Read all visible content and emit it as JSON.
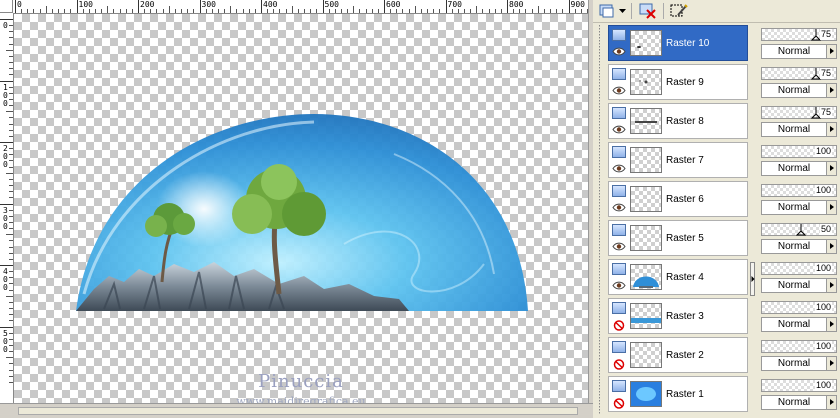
{
  "ruler": {
    "horizontal_labels": [
      "0",
      "100",
      "200",
      "300",
      "400",
      "500",
      "600",
      "700",
      "800",
      "900"
    ],
    "vertical_labels": [
      "0",
      "1 0 0",
      "2 0 0",
      "3 0 0",
      "4 0 0",
      "5 0 0"
    ]
  },
  "canvas": {
    "watermark_title": "Pinuccia",
    "watermark_url": "www.maidiregrafica.eu"
  },
  "toolbar": {
    "icons": [
      "new-layer-icon",
      "dropdown-arrow-icon",
      "delete-layer-icon",
      "edit-selection-icon"
    ]
  },
  "layers": [
    {
      "name": "Raster 10",
      "selected": true,
      "visible": true,
      "opacity": "75",
      "blend": "Normal"
    },
    {
      "name": "Raster 9",
      "selected": false,
      "visible": true,
      "opacity": "75",
      "blend": "Normal"
    },
    {
      "name": "Raster 8",
      "selected": false,
      "visible": true,
      "opacity": "75",
      "blend": "Normal"
    },
    {
      "name": "Raster 7",
      "selected": false,
      "visible": true,
      "opacity": "100",
      "blend": "Normal"
    },
    {
      "name": "Raster 6",
      "selected": false,
      "visible": true,
      "opacity": "100",
      "blend": "Normal"
    },
    {
      "name": "Raster 5",
      "selected": false,
      "visible": true,
      "opacity": "50",
      "blend": "Normal"
    },
    {
      "name": "Raster 4",
      "selected": false,
      "visible": true,
      "opacity": "100",
      "blend": "Normal"
    },
    {
      "name": "Raster 3",
      "selected": false,
      "visible": false,
      "opacity": "100",
      "blend": "Normal"
    },
    {
      "name": "Raster 2",
      "selected": false,
      "visible": false,
      "opacity": "100",
      "blend": "Normal"
    },
    {
      "name": "Raster 1",
      "selected": false,
      "visible": false,
      "opacity": "100",
      "blend": "Normal"
    }
  ],
  "colors": {
    "selection": "#316ac5",
    "panel": "#ece9d8",
    "sky_blue": "#3a9fe0"
  }
}
